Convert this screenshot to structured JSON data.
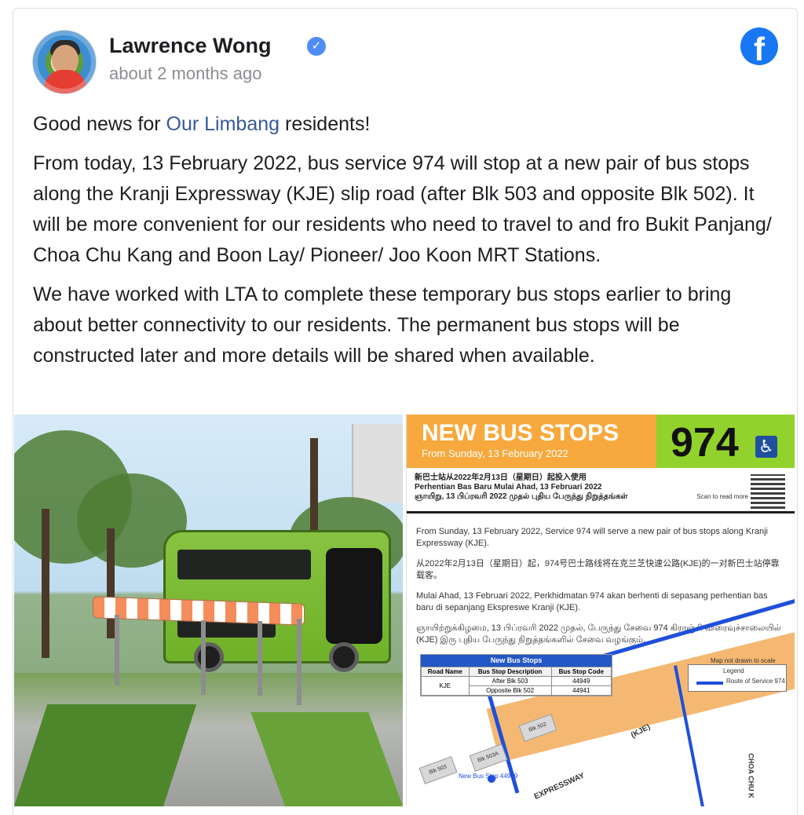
{
  "post": {
    "author": "Lawrence Wong",
    "time": "about 2 months ago",
    "text": {
      "line1_prefix": "Good news for ",
      "link": "Our Limbang",
      "line1_suffix": " residents!",
      "paragraph2": "From today, 13 February 2022, bus service 974 will stop at a new pair of bus stops along the Kranji Expressway (KJE) slip road (after Blk 503 and opposite Blk 502). It will be more convenient for our residents who need to travel to and fro Bukit Panjang/ Choa Chu Kang and Boon Lay/ Pioneer/ Joo Koon MRT Stations.",
      "paragraph3": "We have worked with LTA to complete these temporary bus stops earlier to bring about better connectivity to our residents. The permanent bus stops will be constructed later and more details will be shared when available."
    }
  },
  "poster": {
    "title": "NEW BUS STOPS",
    "subtitle": "From Sunday, 13 February 2022",
    "service": "974",
    "lang_line_1": "新巴士站从2022年2月13日（星期日）起投入使用",
    "lang_line_2": "Perhentian Bas Baru Mulai Ahad, 13 Februari 2022",
    "lang_line_3": "ஞாயிறு, 13 பிப்ரவரி 2022 முதல் புதிய பேருந்து நிறுத்தங்கள்",
    "scan": "Scan to read more",
    "body1": "From Sunday, 13 February 2022, Service 974 will serve a new pair of bus stops along Kranji Expressway (KJE).",
    "body2": "从2022年2月13日（星期日）起，974号巴士路线将在克兰芝快速公路(KJE)的一对新巴士站停靠载客。",
    "body3": "Mulai Ahad, 13 Februari 2022, Perkhidmatan 974 akan berhenti di sepasang perhentian bas baru di sepanjang Ekspreswe Kranji (KJE).",
    "body4": "ஞாயிற்றுக்கிழமை, 13 பிப்ரவரி 2022 முதல், பேருந்து சேவை 974 கிராஞ்சி விரைவுச்சாலையில் (KJE) இரு புதிய பேருந்து நிறுத்தங்களில் சேவை வழங்கும்.",
    "table": {
      "title": "New Bus Stops",
      "headers": [
        "Road Name",
        "Bus Stop Description",
        "Bus Stop Code"
      ],
      "rows": [
        [
          "KJE",
          "After Blk 503",
          "44949"
        ],
        [
          "",
          "Opposite Blk 502",
          "44941"
        ]
      ]
    },
    "map_note": "Map not drawn to scale",
    "legend_title": "Legend",
    "legend_label": "Route of Service 974",
    "blocks": [
      "Blk 503",
      "Blk 503A",
      "Blk 502"
    ],
    "road_1": "(KJE)",
    "road_2": "EXPRESSWAY",
    "road_3": "CHOA CHU K",
    "stop_label": "New Bus Stop 44949"
  }
}
